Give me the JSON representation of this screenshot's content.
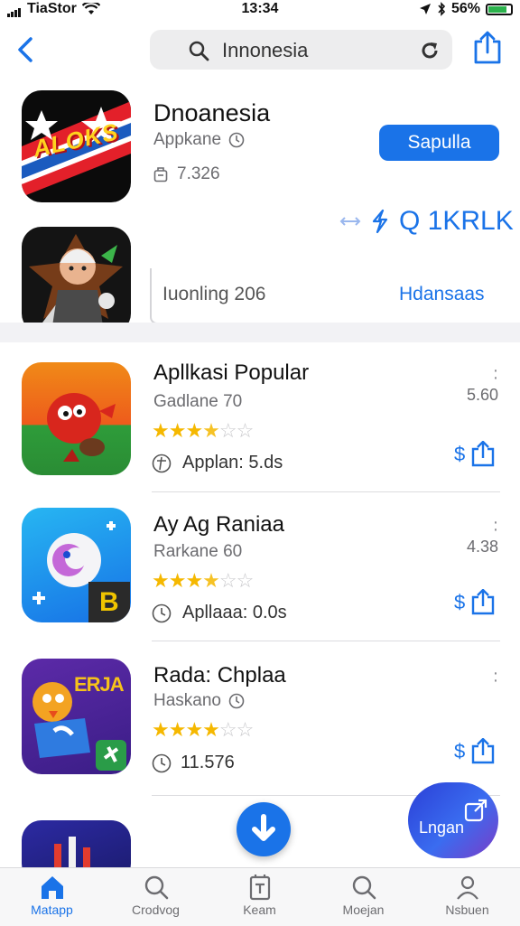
{
  "status": {
    "carrier": "TiaStor",
    "time": "13:34",
    "battery": "56%"
  },
  "search": {
    "query": "Innonesia"
  },
  "featured": {
    "title": "Dnoanesia",
    "subtitle": "Appkane",
    "count": "7.326",
    "button": "Sapulla",
    "promo": "Q 1KRLK",
    "icon_text": "ALOKS"
  },
  "panel": {
    "left": "Iuonling 206",
    "right": "Hdansaas"
  },
  "apps": [
    {
      "title": "Apllkasi Popular",
      "subtitle": "Gadlane 70",
      "rating": 3.5,
      "meta": "Applan: 5.ds",
      "size": "5.60",
      "price": "$",
      "meta_icon": "globe-icon",
      "icon_text": ""
    },
    {
      "title": "Ay Ag Raniaa",
      "subtitle": "Rarkane 60",
      "rating": 3.5,
      "meta": "Apllaaa: 0.0s",
      "size": "4.38",
      "price": "$",
      "meta_icon": "clock-icon",
      "icon_text": "B"
    },
    {
      "title": "Rada: Chplaa",
      "subtitle": "Haskano",
      "rating": 4,
      "meta": "11.576",
      "size": "",
      "price": "$",
      "meta_icon": "clock-icon",
      "icon_text": "ERJA"
    }
  ],
  "fab": {
    "login": "Lngan"
  },
  "tabs": [
    {
      "label": "Matapp",
      "icon": "home-icon"
    },
    {
      "label": "Crodvog",
      "icon": "search-icon"
    },
    {
      "label": "Keam",
      "icon": "document-icon"
    },
    {
      "label": "Moejan",
      "icon": "search-icon"
    },
    {
      "label": "Nsbuen",
      "icon": "person-icon"
    }
  ]
}
